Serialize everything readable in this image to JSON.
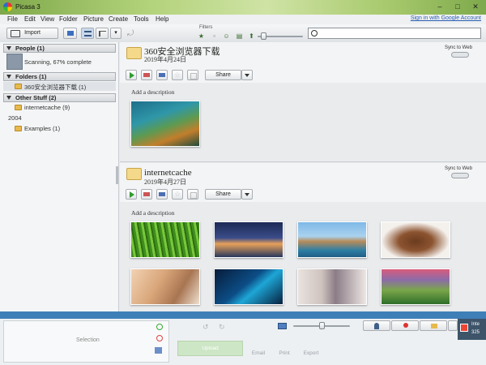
{
  "window": {
    "title": "Picasa 3",
    "controls": [
      "–",
      "□",
      "✕"
    ]
  },
  "menu": {
    "items": [
      "File",
      "Edit",
      "View",
      "Folder",
      "Picture",
      "Create",
      "Tools",
      "Help"
    ],
    "signin": "Sign in with Google Account"
  },
  "toolbar": {
    "import_label": "Import",
    "filters_label": "Filters",
    "search_placeholder": ""
  },
  "sidebar": {
    "people_header": "People (1)",
    "scanning_text": "Scanning, 67% complete",
    "scanning_progress": 0.67,
    "folders_header": "Folders (1)",
    "folders": [
      {
        "label": "360安全浏览器下载 (1)"
      }
    ],
    "other_header": "Other Stuff (2)",
    "other_items": [
      {
        "label": "internetcache (9)"
      }
    ],
    "year": "2004",
    "year_items": [
      {
        "label": "Examples (1)"
      }
    ]
  },
  "albums": [
    {
      "title": "360安全浏览器下载",
      "date": "2019年4月24日",
      "sync_label": "Sync to Web",
      "share_label": "Share",
      "desc_placeholder": "Add a description",
      "photo_count": 1
    },
    {
      "title": "internetcache",
      "date": "2019年4月27日",
      "sync_label": "Sync to Web",
      "share_label": "Share",
      "desc_placeholder": "Add a description",
      "photo_count": 8
    }
  ],
  "bottom": {
    "selection_label": "Selection",
    "upload_label": "Upload",
    "actions": [
      "Email",
      "Print",
      "Export"
    ],
    "notify_line1": "Inte",
    "notify_line2": "325"
  },
  "colors": {
    "accent_bar": "#3f7fb8",
    "title_green": "#a7c96c"
  }
}
